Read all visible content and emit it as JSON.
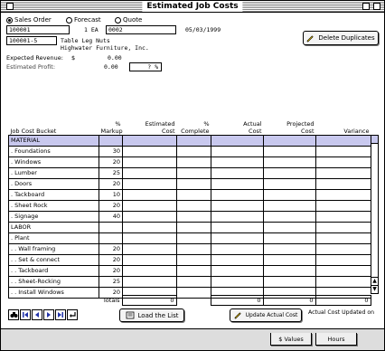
{
  "window": {
    "title": "Estimated Job Costs"
  },
  "top": {
    "radios": [
      {
        "label": "Sales Order",
        "selected": true
      },
      {
        "label": "Forecast",
        "selected": false
      },
      {
        "label": "Quote",
        "selected": false
      }
    ],
    "order_no": "100001",
    "qty": "1 EA",
    "item_no": "0002",
    "date": "05/03/1999",
    "part_no": "100001-5",
    "part_desc": "Table Leg Nuts",
    "customer": "Highwater Furniture, Inc.",
    "expected_revenue_label": "Expected Revenue:",
    "expected_revenue_currency": "$",
    "expected_revenue": "0.00",
    "estimated_profit_label": "Estimated Profit:",
    "estimated_profit": "0.00",
    "estimated_profit_pct": "? %",
    "delete_button": "Delete Duplicates"
  },
  "columns": {
    "bucket": "Job Cost Bucket",
    "markup_top": "%",
    "markup": "Markup",
    "est_top": "Estimated",
    "est": "Cost",
    "complete_top": "%",
    "complete": "Complete",
    "actual_top": "Actual",
    "actual": "Cost",
    "proj_top": "Projected",
    "proj": "Cost",
    "variance": "Variance"
  },
  "rows": [
    {
      "name": "MATERIAL",
      "markup": "",
      "category": true
    },
    {
      "name": ". Foundations",
      "markup": "30"
    },
    {
      "name": ". Windows",
      "markup": "20"
    },
    {
      "name": ". Lumber",
      "markup": "25"
    },
    {
      "name": ". Doors",
      "markup": "20"
    },
    {
      "name": ". Tackboard",
      "markup": "10"
    },
    {
      "name": ". Sheet Rock",
      "markup": "20"
    },
    {
      "name": ". Signage",
      "markup": "40"
    },
    {
      "name": "LABOR",
      "markup": ""
    },
    {
      "name": ". Plant",
      "markup": ""
    },
    {
      "name": ". . Wall framing",
      "markup": "20"
    },
    {
      "name": ". . Set & connect",
      "markup": "20"
    },
    {
      "name": ". . Tackboard",
      "markup": "20"
    },
    {
      "name": ". . Sheet-Rocking",
      "markup": "25"
    },
    {
      "name": ". . Install Windows",
      "markup": "20"
    }
  ],
  "totals": {
    "label": "Totals",
    "est": "0",
    "actual": "0",
    "proj": "0",
    "variance": "0"
  },
  "bottom": {
    "load_button": "Load the List",
    "update_button": "Update Actual Cost",
    "updated_label": "Actual Cost Updated on"
  },
  "tabs": [
    {
      "label": "$ Values"
    },
    {
      "label": "Hours"
    }
  ]
}
